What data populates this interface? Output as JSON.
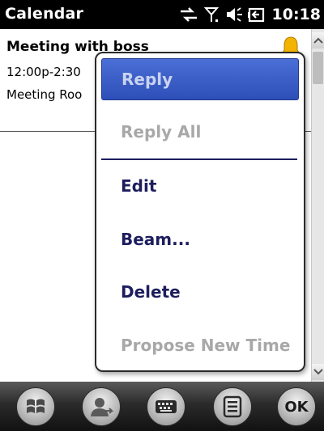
{
  "titlebar": {
    "title": "Calendar",
    "clock": "10:18"
  },
  "appointment": {
    "subject": "Meeting with boss",
    "time": "12:00p-2:30",
    "location": "Meeting Roo"
  },
  "menu": {
    "items": [
      {
        "label": "Reply",
        "state": "selected"
      },
      {
        "label": "Reply All",
        "state": "disabled"
      },
      {
        "label": "Edit",
        "state": "enabled"
      },
      {
        "label": "Beam...",
        "state": "enabled"
      },
      {
        "label": "Delete",
        "state": "enabled"
      },
      {
        "label": "Propose New Time",
        "state": "disabled"
      }
    ]
  },
  "softkeys": {
    "ok_label": "OK",
    "icons": [
      "windows-start-icon",
      "contacts-icon",
      "keyboard-icon",
      "menu-icon",
      "ok-icon"
    ]
  },
  "colors": {
    "titlebar_bg": "#000000",
    "menu_text": "#1d1d5e",
    "menu_disabled": "#a8a8a8",
    "selection": "#3a5cc6"
  }
}
